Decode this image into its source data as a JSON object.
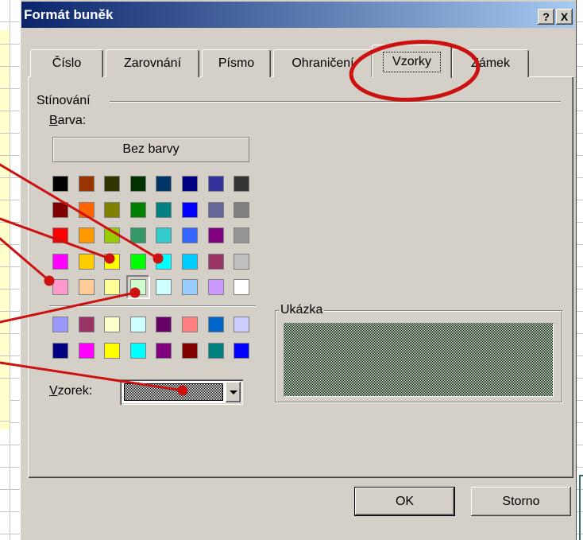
{
  "window": {
    "title": "Formát buněk",
    "help_glyph": "?",
    "close_glyph": "X",
    "titlebar_colors": [
      "#0a246a",
      "#a6caf0"
    ]
  },
  "tabs": [
    {
      "label": "Číslo",
      "selected": false
    },
    {
      "label": "Zarovnání",
      "selected": false
    },
    {
      "label": "Písmo",
      "selected": false
    },
    {
      "label": "Ohraničení",
      "selected": false
    },
    {
      "label": "Vzorky",
      "selected": true
    },
    {
      "label": "Zámek",
      "selected": false
    }
  ],
  "shading": {
    "group_label": "Stínování",
    "color_label": "Barva:",
    "no_color_button": "Bez barvy",
    "palette_main": [
      "#000000",
      "#993300",
      "#333300",
      "#003300",
      "#003366",
      "#000080",
      "#333399",
      "#333333",
      "#800000",
      "#FF6600",
      "#808000",
      "#008000",
      "#008080",
      "#0000FF",
      "#666699",
      "#808080",
      "#FF0000",
      "#FF9900",
      "#99CC00",
      "#339966",
      "#33CCCC",
      "#3366FF",
      "#800080",
      "#969696",
      "#FF00FF",
      "#FFCC00",
      "#FFFF00",
      "#00FF00",
      "#00FFFF",
      "#00CCFF",
      "#993366",
      "#C0C0C0",
      "#FF99CC",
      "#FFCC99",
      "#FFFF99",
      "#CCFFCC",
      "#CCFFFF",
      "#99CCFF",
      "#CC99FF",
      "#FFFFFF"
    ],
    "palette_chart": [
      "#9999FF",
      "#993366",
      "#FFFFCC",
      "#CCFFFF",
      "#660066",
      "#FF8080",
      "#0066CC",
      "#CCCCFF",
      "#000080",
      "#FF00FF",
      "#FFFF00",
      "#00FFFF",
      "#800080",
      "#800000",
      "#008080",
      "#0000FF"
    ],
    "selected_color": "#CCFFCC",
    "pattern_label": "Vzorek:",
    "pattern_swatch": {
      "foreground": "#000000",
      "background": "#FFFFFF"
    }
  },
  "sample": {
    "group_label": "Ukázka",
    "background": "#CCFFCC",
    "pattern_color": "#000000"
  },
  "buttons": {
    "ok": "OK",
    "cancel": "Storno"
  },
  "annotation_color": "#cc1111"
}
